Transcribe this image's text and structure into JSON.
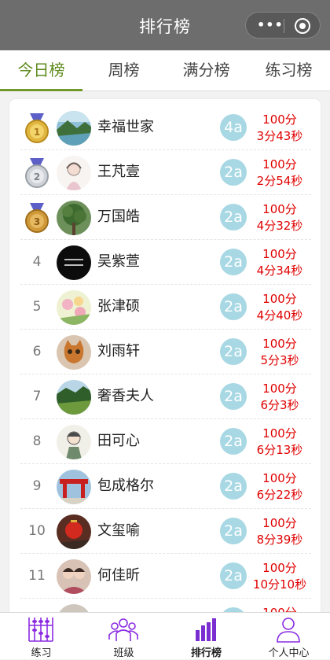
{
  "navbar": {
    "title": "排行榜"
  },
  "tabs": [
    {
      "label": "今日榜",
      "active": true
    },
    {
      "label": "周榜",
      "active": false
    },
    {
      "label": "满分榜",
      "active": false
    },
    {
      "label": "练习榜",
      "active": false
    }
  ],
  "colors": {
    "accent": "#6f9a2a",
    "score": "#e00000",
    "class_badge": "#a8d8e4",
    "tab_active_icon": "#7a2ed1"
  },
  "rows": [
    {
      "rank": "1",
      "medal": "gold",
      "name": "幸福世家",
      "cls": "4a",
      "score": "100分",
      "time": "3分43秒",
      "avatar": "landscape-avatar"
    },
    {
      "rank": "2",
      "medal": "silver",
      "name": "王芃壹",
      "cls": "2a",
      "score": "100分",
      "time": "2分54秒",
      "avatar": "sketch-girl-avatar"
    },
    {
      "rank": "3",
      "medal": "bronze",
      "name": "万国皓",
      "cls": "2a",
      "score": "100分",
      "time": "4分32秒",
      "avatar": "tree-avatar"
    },
    {
      "rank": "4",
      "medal": "",
      "name": "吴紫萱",
      "cls": "2a",
      "score": "100分",
      "time": "4分34秒",
      "avatar": "black-text-avatar"
    },
    {
      "rank": "5",
      "medal": "",
      "name": "张津硕",
      "cls": "2a",
      "score": "100分",
      "time": "4分40秒",
      "avatar": "flowers-avatar"
    },
    {
      "rank": "6",
      "medal": "",
      "name": "刘雨轩",
      "cls": "2a",
      "score": "100分",
      "time": "5分3秒",
      "avatar": "cat-avatar"
    },
    {
      "rank": "7",
      "medal": "",
      "name": "奢香夫人",
      "cls": "2a",
      "score": "100分",
      "time": "6分3秒",
      "avatar": "field-avatar"
    },
    {
      "rank": "8",
      "medal": "",
      "name": "田可心",
      "cls": "2a",
      "score": "100分",
      "time": "6分13秒",
      "avatar": "cartoon-avatar"
    },
    {
      "rank": "9",
      "medal": "",
      "name": "包成格尔",
      "cls": "2a",
      "score": "100分",
      "time": "6分22秒",
      "avatar": "red-gate-avatar"
    },
    {
      "rank": "10",
      "medal": "",
      "name": "文玺喻",
      "cls": "2a",
      "score": "100分",
      "time": "8分39秒",
      "avatar": "red-lantern-avatar"
    },
    {
      "rank": "11",
      "medal": "",
      "name": "何佳昕",
      "cls": "2a",
      "score": "100分",
      "time": "10分10秒",
      "avatar": "couple-avatar"
    }
  ],
  "partial_row": {
    "score": "100分"
  },
  "bottom_tabs": [
    {
      "label": "练习",
      "icon": "abacus-icon",
      "active": false
    },
    {
      "label": "班级",
      "icon": "group-icon",
      "active": false
    },
    {
      "label": "排行榜",
      "icon": "bar-chart-icon",
      "active": true
    },
    {
      "label": "个人中心",
      "icon": "person-icon",
      "active": false
    }
  ]
}
